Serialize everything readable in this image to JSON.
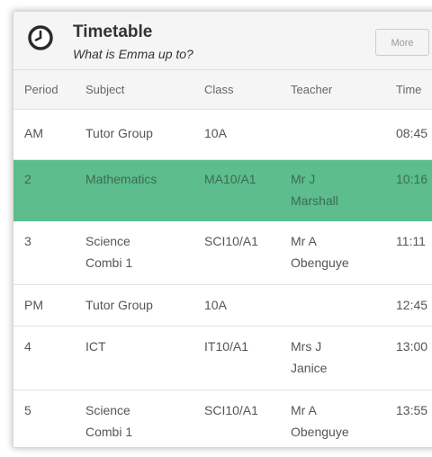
{
  "header": {
    "title": "Timetable",
    "subtitle": "What is Emma up to?",
    "more_label": "More",
    "icon": "clock-icon"
  },
  "columns": {
    "period": "Period",
    "subject": "Subject",
    "class": "Class",
    "teacher": "Teacher",
    "time": "Time"
  },
  "rows": [
    {
      "period": "AM",
      "subject": "Tutor Group",
      "class": "10A",
      "teacher": "",
      "time": "08:45"
    },
    {
      "period": "2",
      "subject": "Mathematics",
      "class": "MA10/A1",
      "teacher": "Mr J Marshall",
      "time": "10:16",
      "highlighted": true
    },
    {
      "period": "3",
      "subject": "Science Combi 1",
      "class": "SCI10/A1",
      "teacher": "Mr A Obenguye",
      "time": "11:11"
    },
    {
      "period": "PM",
      "subject": "Tutor Group",
      "class": "10A",
      "teacher": "",
      "time": "12:45"
    },
    {
      "period": "4",
      "subject": "ICT",
      "class": "IT10/A1",
      "teacher": "Mrs J Janice",
      "time": "13:00"
    },
    {
      "period": "5",
      "subject": "Science Combi 1",
      "class": "SCI10/A1",
      "teacher": "Mr A Obenguye",
      "time": "13:55"
    }
  ],
  "colors": {
    "highlight": "#5dbd8c",
    "header_bg": "#f5f5f5",
    "text": "#555555"
  }
}
